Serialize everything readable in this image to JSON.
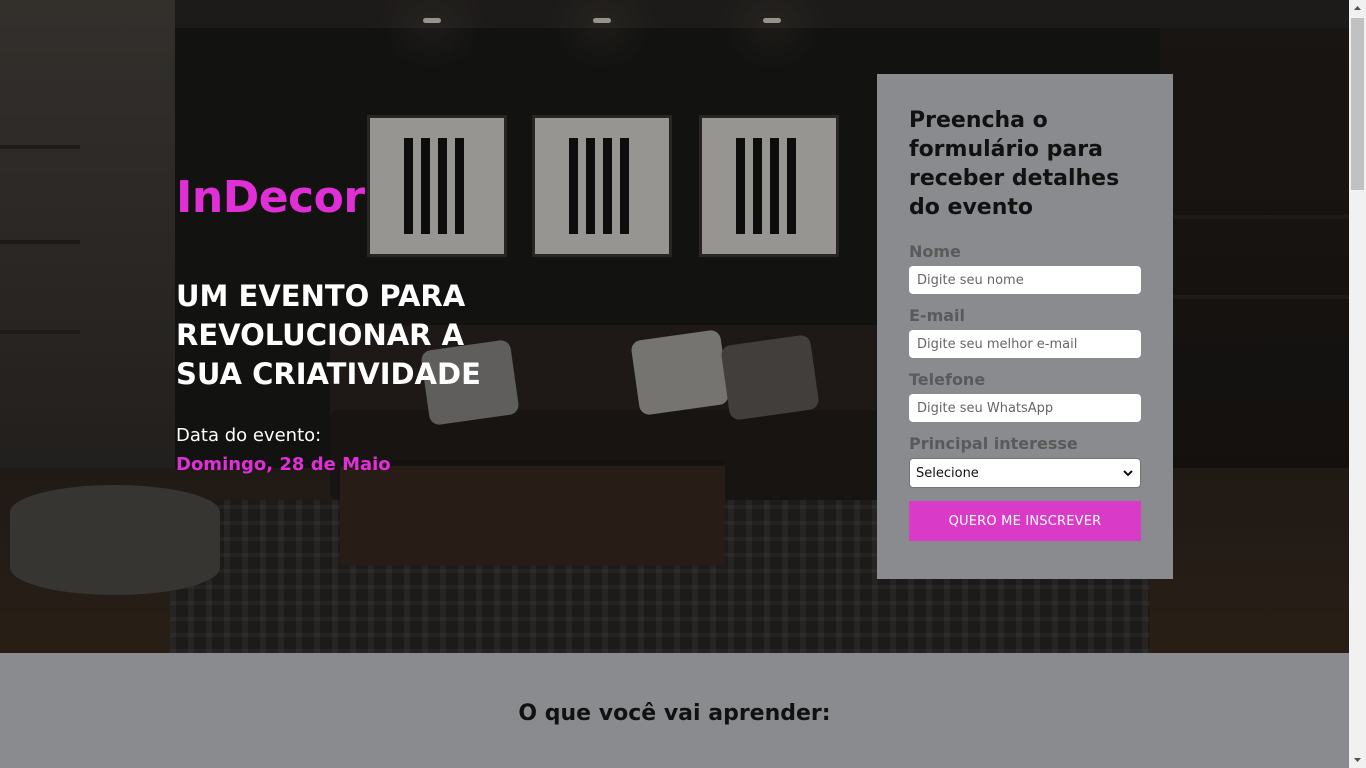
{
  "hero": {
    "brand": "InDecor",
    "headline": "UM EVENTO PARA REVOLUCIONAR A SUA CRIATIVIDADE",
    "event_label": "Data do evento:",
    "event_date": "Domingo, 28 de Maio"
  },
  "form": {
    "title": "Preencha o formulário para receber detalhes do evento",
    "fields": [
      {
        "label": "Nome",
        "placeholder": "Digite seu nome"
      },
      {
        "label": "E-mail",
        "placeholder": "Digite seu melhor e-mail"
      },
      {
        "label": "Telefone",
        "placeholder": "Digite seu WhatsApp"
      }
    ],
    "interest": {
      "label": "Principal interesse",
      "selected": "Selecione"
    },
    "submit_label": "QUERO ME INSCREVER"
  },
  "learn": {
    "title": "O que você vai aprender:"
  },
  "colors": {
    "accent": "#e02fd6",
    "button": "#d93ac8",
    "card": "#898b8e"
  },
  "icons": {
    "select_arrow": "chevron-down-icon",
    "scroll_up": "scroll-up-arrow-icon",
    "scroll_down": "scroll-down-arrow-icon"
  }
}
